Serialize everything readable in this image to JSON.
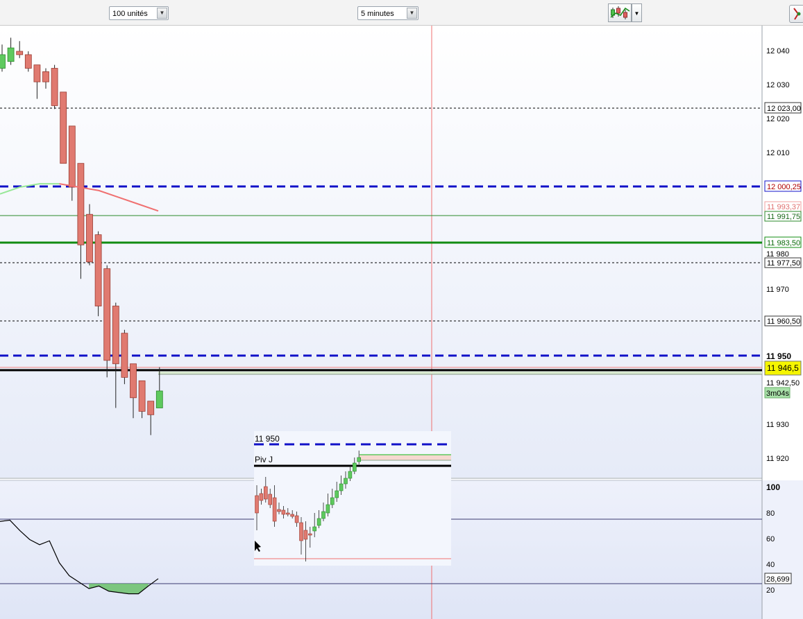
{
  "toolbar": {
    "units_selected": "100 unités",
    "interval_selected": "5 minutes",
    "chart_style_icon": "candlestick-chart-icon",
    "side_icon": "tool-icon"
  },
  "price_axis": {
    "ticks": [
      "12 040",
      "12 030",
      "12 020",
      "12 010",
      "11 980",
      "11 970",
      "11 930",
      "11 920"
    ],
    "level_950": "11 950",
    "level_942": "11 942,50"
  },
  "price_labels": {
    "l12023": "12 023,00",
    "l12000": "12 000,25",
    "l11993": "11 993,37",
    "l11991": "11 991,75",
    "l11983": "11 983,50",
    "l11977": "11 977,50",
    "l11960": "11 960,50",
    "current": "11 946,5",
    "timer": "3m04s"
  },
  "indicator_axis": {
    "ticks": [
      "100",
      "80",
      "60",
      "40",
      "20"
    ],
    "value": "28,699"
  },
  "overlay": {
    "label_level": "11 950",
    "label_pivot": "Piv J"
  },
  "colors": {
    "bull": "#5ec95e",
    "bear": "#e07a70",
    "blue_dash": "#1010c8",
    "green_level": "#128c12",
    "current_price": "#f5f500"
  },
  "chart_data": [
    {
      "type": "candlestick",
      "ylim": [
        11913,
        12048
      ],
      "candles": [
        {
          "o": 12035,
          "h": 12042,
          "l": 12034,
          "c": 12039
        },
        {
          "o": 12037,
          "h": 12044,
          "l": 12036,
          "c": 12041
        },
        {
          "o": 12040,
          "h": 12043,
          "l": 12038,
          "c": 12039
        },
        {
          "o": 12039,
          "h": 12040,
          "l": 12034,
          "c": 12035
        },
        {
          "o": 12036,
          "h": 12036,
          "l": 12026,
          "c": 12031
        },
        {
          "o": 12034,
          "h": 12035,
          "l": 12029,
          "c": 12031
        },
        {
          "o": 12035,
          "h": 12036,
          "l": 12023,
          "c": 12024
        },
        {
          "o": 12028,
          "h": 12028,
          "l": 12010,
          "c": 12007
        },
        {
          "o": 12018,
          "h": 12018,
          "l": 11996,
          "c": 12000
        },
        {
          "o": 12007,
          "h": 12007,
          "l": 11973,
          "c": 11983
        },
        {
          "o": 11992,
          "h": 11995,
          "l": 11977,
          "c": 11978
        },
        {
          "o": 11986,
          "h": 11987,
          "l": 11962,
          "c": 11965
        },
        {
          "o": 11976,
          "h": 11977,
          "l": 11944,
          "c": 11949
        },
        {
          "o": 11965,
          "h": 11966,
          "l": 11935,
          "c": 11948
        },
        {
          "o": 11957,
          "h": 11958,
          "l": 11942,
          "c": 11944
        },
        {
          "o": 11948,
          "h": 11948,
          "l": 11932,
          "c": 11938
        },
        {
          "o": 11943,
          "h": 11943,
          "l": 11932,
          "c": 11934
        },
        {
          "o": 11937,
          "h": 11937,
          "l": 11927,
          "c": 11933
        },
        {
          "o": 11935,
          "h": 11947,
          "l": 11935,
          "c": 11940
        }
      ],
      "moving_average": [
        11998,
        12000,
        12001,
        12001,
        12000,
        11999,
        11997,
        11995,
        11993
      ]
    },
    {
      "type": "line",
      "ylim": [
        0,
        105
      ],
      "values": [
        73,
        74,
        66,
        59,
        55,
        58,
        41,
        31,
        26,
        21,
        23,
        19,
        18,
        17,
        17,
        23,
        28.699
      ],
      "levels": [
        75,
        25
      ]
    }
  ]
}
